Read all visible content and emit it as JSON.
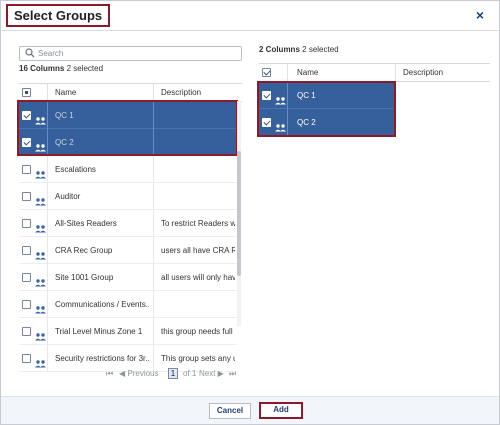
{
  "dialog": {
    "title": "Select Groups",
    "close_glyph": "×"
  },
  "left": {
    "search_placeholder": "Search",
    "count_bold": "16 Columns",
    "count_rest": "2 selected",
    "columns": {
      "name": "Name",
      "description": "Description"
    },
    "rows": [
      {
        "name": "QC 1",
        "description": "",
        "selected": true
      },
      {
        "name": "QC 2",
        "description": "",
        "selected": true
      },
      {
        "name": "Escalations",
        "description": "",
        "selected": false
      },
      {
        "name": "Auditor",
        "description": "",
        "selected": false
      },
      {
        "name": "All-Sites Readers",
        "description": "To restrict Readers wo",
        "selected": false
      },
      {
        "name": "CRA Rec Group",
        "description": "users all have CRA Rec",
        "selected": false
      },
      {
        "name": "Site 1001 Group",
        "description": "all users will only have",
        "selected": false
      },
      {
        "name": "Communications / Events...",
        "description": "",
        "selected": false
      },
      {
        "name": "Trial Level Minus Zone 1",
        "description": "this group needs full a",
        "selected": false
      },
      {
        "name": "Security restrictions for 3r...",
        "description": "This group sets any us",
        "selected": false
      }
    ],
    "pager": {
      "first": "⏮",
      "previous": "◀ Previous",
      "page": "1",
      "of": "of 1",
      "next": "Next ▶",
      "last": "⏭"
    }
  },
  "right": {
    "count_bold": "2 Columns",
    "count_rest": "2 selected",
    "columns": {
      "name": "Name",
      "description": "Description"
    },
    "rows": [
      {
        "name": "QC 1",
        "description": ""
      },
      {
        "name": "QC 2",
        "description": ""
      }
    ]
  },
  "footer": {
    "cancel_label": "Cancel",
    "add_label": "Add"
  },
  "colors": {
    "selected_row": "#35609b",
    "highlight_border": "#8b1a2b",
    "link_blue": "#1f3f7a"
  },
  "icons": {
    "search": "search-icon",
    "group": "group-icon",
    "close": "close-icon"
  }
}
